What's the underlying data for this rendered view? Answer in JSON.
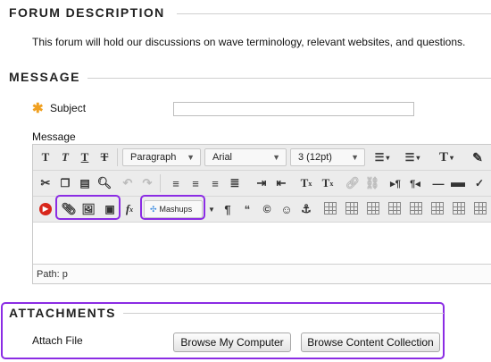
{
  "forum_description": {
    "heading": "FORUM DESCRIPTION",
    "text": "This forum will hold our discussions on wave terminology, relevant websites, and questions."
  },
  "message_section": {
    "heading": "MESSAGE",
    "subject_label": "Subject",
    "subject_value": "",
    "message_label": "Message"
  },
  "editor": {
    "format_select": "Paragraph",
    "font_select": "Arial",
    "size_select": "3 (12pt)",
    "mashups_label": "Mashups",
    "path_label": "Path:",
    "path_value": "p"
  },
  "attachments": {
    "heading": "ATTACHMENTS",
    "attach_label": "Attach File",
    "browse_computer": "Browse My Computer",
    "browse_collection": "Browse Content Collection"
  },
  "colors": {
    "highlight": "#8b2ce4",
    "required_star": "#f0a020",
    "youtube_red": "#d8261b"
  }
}
